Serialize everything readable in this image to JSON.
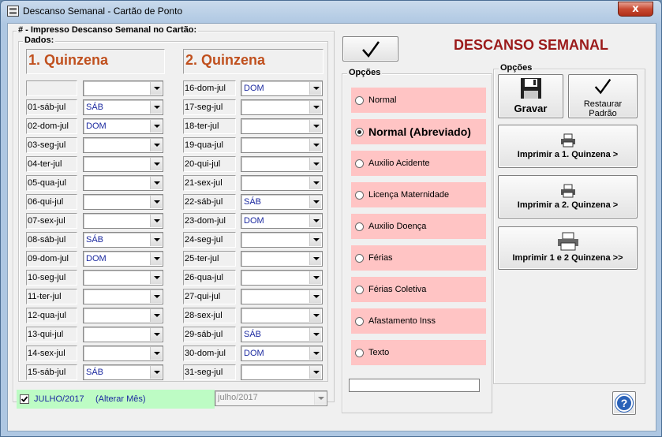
{
  "window": {
    "title": "Descanso Semanal - Cartão de Ponto",
    "close_glyph": "x"
  },
  "main_group_label": "# - Impresso Descanso Semanal no Cartão:",
  "dados": {
    "label": "Dados:",
    "q1_title": "1. Quinzena",
    "q2_title": "2. Quinzena",
    "q1_rows": [
      {
        "label": "",
        "value": ""
      },
      {
        "label": "01-sáb-jul",
        "value": "SÁB"
      },
      {
        "label": "02-dom-jul",
        "value": "DOM"
      },
      {
        "label": "03-seg-jul",
        "value": ""
      },
      {
        "label": "04-ter-jul",
        "value": ""
      },
      {
        "label": "05-qua-jul",
        "value": ""
      },
      {
        "label": "06-qui-jul",
        "value": ""
      },
      {
        "label": "07-sex-jul",
        "value": ""
      },
      {
        "label": "08-sáb-jul",
        "value": "SÁB"
      },
      {
        "label": "09-dom-jul",
        "value": "DOM"
      },
      {
        "label": "10-seg-jul",
        "value": ""
      },
      {
        "label": "11-ter-jul",
        "value": ""
      },
      {
        "label": "12-qua-jul",
        "value": ""
      },
      {
        "label": "13-qui-jul",
        "value": ""
      },
      {
        "label": "14-sex-jul",
        "value": ""
      },
      {
        "label": "15-sáb-jul",
        "value": "SÁB"
      }
    ],
    "q2_rows": [
      {
        "label": "16-dom-jul",
        "value": "DOM"
      },
      {
        "label": "17-seg-jul",
        "value": ""
      },
      {
        "label": "18-ter-jul",
        "value": ""
      },
      {
        "label": "19-qua-jul",
        "value": ""
      },
      {
        "label": "20-qui-jul",
        "value": ""
      },
      {
        "label": "21-sex-jul",
        "value": ""
      },
      {
        "label": "22-sáb-jul",
        "value": "SÁB"
      },
      {
        "label": "23-dom-jul",
        "value": "DOM"
      },
      {
        "label": "24-seg-jul",
        "value": ""
      },
      {
        "label": "25-ter-jul",
        "value": ""
      },
      {
        "label": "26-qua-jul",
        "value": ""
      },
      {
        "label": "27-qui-jul",
        "value": ""
      },
      {
        "label": "28-sex-jul",
        "value": ""
      },
      {
        "label": "29-sáb-jul",
        "value": "SÁB"
      },
      {
        "label": "30-dom-jul",
        "value": "DOM"
      },
      {
        "label": "31-seg-jul",
        "value": ""
      }
    ]
  },
  "month": {
    "checked": true,
    "label": "JULHO/2017",
    "alter_label": "(Alterar Mês)",
    "select_value": "julho/2017"
  },
  "confirm_button": {
    "icon": "checkmark-icon"
  },
  "heading": "DESCANSO SEMANAL",
  "options": {
    "label": "Opções",
    "items": [
      {
        "label": "Normal",
        "selected": false
      },
      {
        "label": "Normal (Abreviado)",
        "selected": true
      },
      {
        "label": "Auxilio Acidente",
        "selected": false
      },
      {
        "label": "Licença Maternidade",
        "selected": false
      },
      {
        "label": "Auxilio Doença",
        "selected": false
      },
      {
        "label": "Férias",
        "selected": false
      },
      {
        "label": "Férias Coletiva",
        "selected": false
      },
      {
        "label": "Afastamento Inss",
        "selected": false
      },
      {
        "label": "Texto",
        "selected": false
      }
    ],
    "text_value": ""
  },
  "actions": {
    "label": "Opções",
    "save": "Gravar",
    "restore_line1": "Restaurar",
    "restore_line2": "Padrão",
    "print1": "Imprimir a 1. Quinzena >",
    "print2": "Imprimir a 2. Quinzena >",
    "print_both": "Imprimir 1 e 2 Quinzena >>"
  },
  "help": {
    "glyph": "?"
  },
  "colors": {
    "quinzena_title": "#c0501e",
    "heading": "#9b1a1a",
    "combo_value": "#1c2aa0",
    "option_bg": "#ffc4c4",
    "month_bg": "#bdfcc4"
  }
}
